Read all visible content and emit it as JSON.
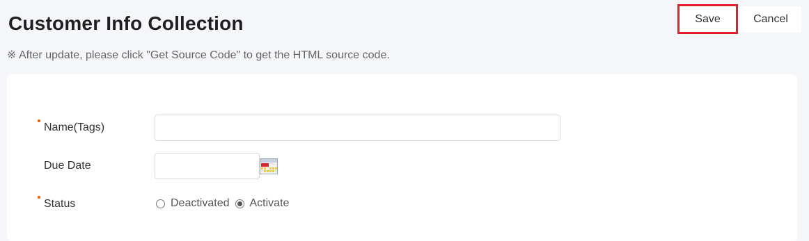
{
  "header": {
    "title": "Customer Info Collection",
    "note": "※ After update, please click \"Get Source Code\" to get the HTML source code."
  },
  "toolbar": {
    "save_label": "Save",
    "cancel_label": "Cancel",
    "highlight_color": "#e0202a"
  },
  "form": {
    "name_label": "Name(Tags)",
    "name_value": "",
    "due_date_label": "Due Date",
    "due_date_value": "",
    "status_label": "Status",
    "status_options": [
      "Deactivated",
      "Activate"
    ],
    "status_selected": "Activate",
    "required_color": "#ff5a00"
  }
}
